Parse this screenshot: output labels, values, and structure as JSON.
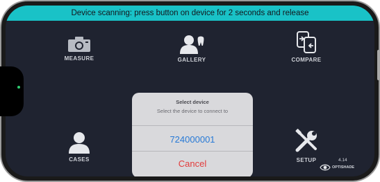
{
  "banner": {
    "text": "Device scanning: press button on device for 2 seconds and release"
  },
  "tiles": {
    "measure": "MEASURE",
    "gallery": "GALLERY",
    "compare": "COMPARE",
    "cases": "CASES",
    "setup": "SETUP"
  },
  "dialog": {
    "title": "Select device",
    "message": "Select the device to connect to",
    "device_option": "724000001",
    "cancel_label": "Cancel"
  },
  "footer": {
    "version": "4.14",
    "brand": "OPTISHADE"
  },
  "colors": {
    "banner": "#19c2c7",
    "background": "#1f2330",
    "device_option": "#2779d6",
    "cancel": "#e23b3b"
  },
  "icons": [
    "camera-icon",
    "gallery-tooth-icon",
    "compare-icon",
    "user-icon",
    "tools-icon",
    "eye-logo-icon"
  ]
}
